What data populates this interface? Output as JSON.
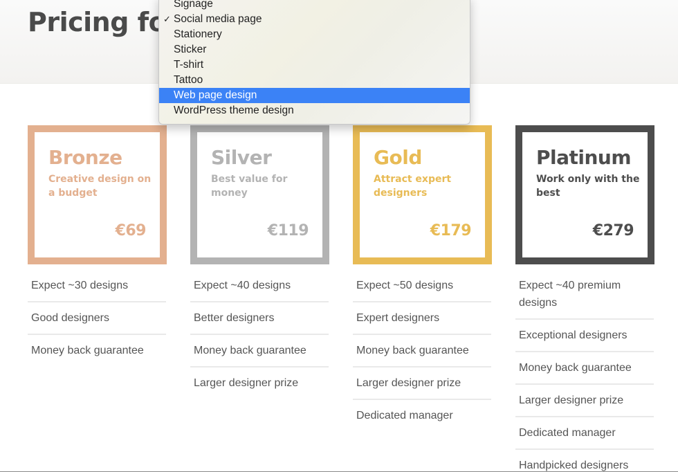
{
  "header": {
    "title": "Pricing for"
  },
  "dropdown": {
    "items": [
      {
        "label": "Signage",
        "checked": false,
        "highlighted": false
      },
      {
        "label": "Social media page",
        "checked": true,
        "highlighted": false
      },
      {
        "label": "Stationery",
        "checked": false,
        "highlighted": false
      },
      {
        "label": "Sticker",
        "checked": false,
        "highlighted": false
      },
      {
        "label": "T-shirt",
        "checked": false,
        "highlighted": false
      },
      {
        "label": "Tattoo",
        "checked": false,
        "highlighted": false
      },
      {
        "label": "Web page design",
        "checked": false,
        "highlighted": true
      },
      {
        "label": "WordPress theme design",
        "checked": false,
        "highlighted": false
      }
    ],
    "check_glyph": "✓",
    "highlight_color": "#3b82f6"
  },
  "tiers": [
    {
      "name": "Bronze",
      "tagline": "Creative design on a budget",
      "price": "€69",
      "color": "#e3b08f",
      "features": [
        "Expect ~30 designs",
        "Good designers",
        "Money back guarantee"
      ]
    },
    {
      "name": "Silver",
      "tagline": "Best value for money",
      "price": "€119",
      "color": "#b3b3b3",
      "features": [
        "Expect ~40 designs",
        "Better designers",
        "Money back guarantee",
        "Larger designer prize"
      ]
    },
    {
      "name": "Gold",
      "tagline": "Attract expert designers",
      "price": "€179",
      "color": "#e8bb55",
      "features": [
        "Expect ~50 designs",
        "Expert designers",
        "Money back guarantee",
        "Larger designer prize",
        "Dedicated manager"
      ]
    },
    {
      "name": "Platinum",
      "tagline": "Work only with the best",
      "price": "€279",
      "color": "#4d4d4d",
      "features": [
        "Expect ~40 premium designs",
        "Exceptional designers",
        "Money back guarantee",
        "Larger designer prize",
        "Dedicated manager",
        "Handpicked designers"
      ]
    }
  ]
}
